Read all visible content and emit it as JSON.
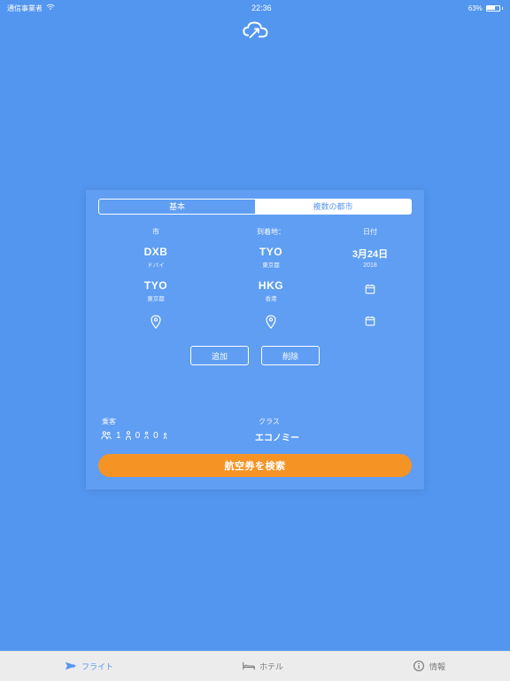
{
  "status": {
    "carrier": "通信事業者",
    "time": "22:36",
    "battery_pct": "63%"
  },
  "tabs": {
    "basic": "基本",
    "multi": "複数の都市"
  },
  "columns": {
    "city": "市",
    "dest": "到着地：",
    "date": "日付"
  },
  "rows": [
    {
      "from_code": "DXB",
      "from_sub": "ドバイ",
      "to_code": "TYO",
      "to_sub": "東京都",
      "date_main": "3月24日",
      "date_sub": "2018"
    },
    {
      "from_code": "TYO",
      "from_sub": "東京都",
      "to_code": "HKG",
      "to_sub": "香港"
    }
  ],
  "buttons": {
    "add": "追加",
    "remove": "削除"
  },
  "lower": {
    "pax_label": "乗客",
    "class_label": "クラス",
    "class_value": "エコノミー"
  },
  "pax": {
    "adult": "1",
    "child": "0",
    "infant": "0"
  },
  "search": "航空券を検索",
  "nav": {
    "flight": "フライト",
    "hotel": "ホテル",
    "info": "情報"
  }
}
